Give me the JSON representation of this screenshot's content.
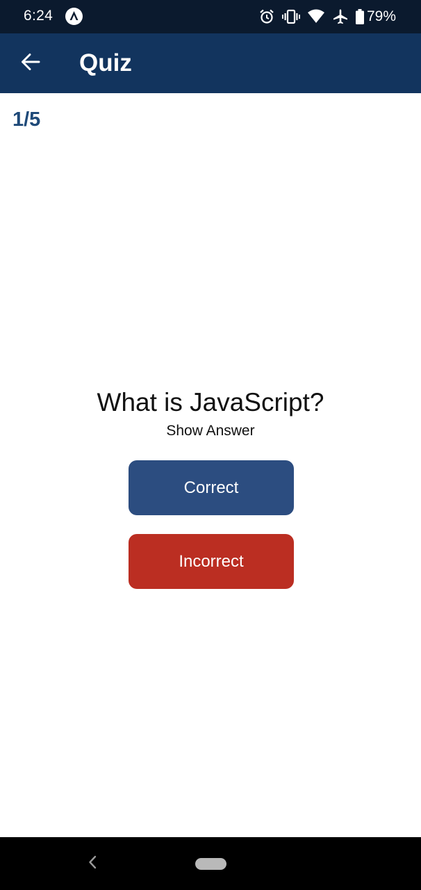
{
  "status_bar": {
    "time": "6:24",
    "battery": "79%",
    "icons": [
      "app-notification-icon",
      "alarm-icon",
      "vibrate-icon",
      "wifi-icon",
      "airplane-icon",
      "battery-icon"
    ]
  },
  "app_bar": {
    "back_icon": "arrow-left-icon",
    "title": "Quiz"
  },
  "quiz": {
    "progress": "1/5",
    "question": "What is JavaScript?",
    "show_answer_label": "Show Answer",
    "correct_label": "Correct",
    "incorrect_label": "Incorrect"
  },
  "nav_bar": {
    "back_icon": "nav-back-icon",
    "home_icon": "home-pill-icon"
  },
  "colors": {
    "status_bar": "#0b1a2e",
    "app_bar": "#12345e",
    "progress_text": "#1f4a79",
    "correct_button": "#2c4d80",
    "incorrect_button": "#bb2e22",
    "nav_bar": "#000000"
  }
}
